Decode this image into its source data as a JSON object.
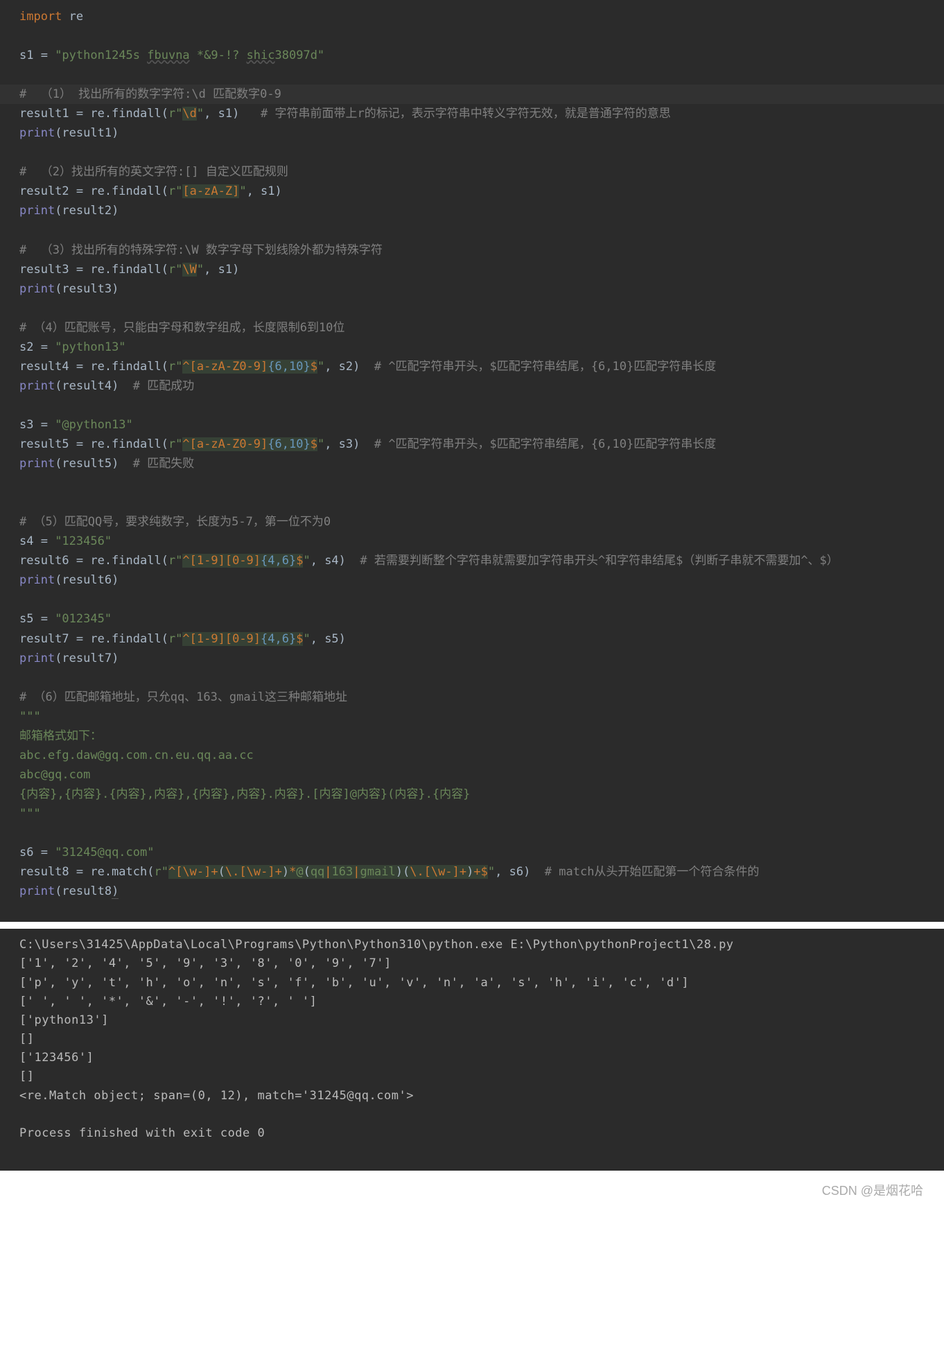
{
  "editor": {
    "lines": [
      {
        "segments": [
          {
            "text": "import ",
            "cls": "kw-import"
          },
          {
            "text": "re",
            "cls": "func"
          }
        ]
      },
      {
        "segments": []
      },
      {
        "segments": [
          {
            "text": "s1 = ",
            "cls": "punct"
          },
          {
            "text": "\"python1245s ",
            "cls": "str"
          },
          {
            "text": "fbuvna",
            "cls": "str-underline"
          },
          {
            "text": " *&9-!? ",
            "cls": "str"
          },
          {
            "text": "shic",
            "cls": "str-underline"
          },
          {
            "text": "38097d\"",
            "cls": "str"
          }
        ]
      },
      {
        "segments": []
      },
      {
        "highlighted": true,
        "segments": [
          {
            "text": "#  （1） 找出所有的数字字符:\\d 匹配数字0-9",
            "cls": "comment"
          }
        ]
      },
      {
        "segments": [
          {
            "text": "result1 = re.findall(",
            "cls": "punct"
          },
          {
            "text": "r\"",
            "cls": "str"
          },
          {
            "text": "\\d",
            "cls": "regex-esc"
          },
          {
            "text": "\"",
            "cls": "str"
          },
          {
            "text": ", s1)   ",
            "cls": "punct"
          },
          {
            "text": "# 字符串前面带上r的标记，表示字符串中转义字符无效，就是普通字符的意思",
            "cls": "comment"
          }
        ]
      },
      {
        "segments": [
          {
            "text": "print",
            "cls": "builtin"
          },
          {
            "text": "(result1)",
            "cls": "punct"
          }
        ]
      },
      {
        "segments": []
      },
      {
        "segments": [
          {
            "text": "#  （2）找出所有的英文字符:[] 自定义匹配规则",
            "cls": "comment"
          }
        ]
      },
      {
        "segments": [
          {
            "text": "result2 = re.findall(",
            "cls": "punct"
          },
          {
            "text": "r\"",
            "cls": "str"
          },
          {
            "text": "[a-zA-Z]",
            "cls": "regex-charclass"
          },
          {
            "text": "\"",
            "cls": "str"
          },
          {
            "text": ", s1)",
            "cls": "punct"
          }
        ]
      },
      {
        "segments": [
          {
            "text": "print",
            "cls": "builtin"
          },
          {
            "text": "(result2)",
            "cls": "punct"
          }
        ]
      },
      {
        "segments": []
      },
      {
        "segments": [
          {
            "text": "#  （3）找出所有的特殊字符:\\W 数字字母下划线除外都为特殊字符",
            "cls": "comment"
          }
        ]
      },
      {
        "segments": [
          {
            "text": "result3 = re.findall(",
            "cls": "punct"
          },
          {
            "text": "r\"",
            "cls": "str"
          },
          {
            "text": "\\W",
            "cls": "regex-esc"
          },
          {
            "text": "\"",
            "cls": "str"
          },
          {
            "text": ", s1)",
            "cls": "punct"
          }
        ]
      },
      {
        "segments": [
          {
            "text": "print",
            "cls": "builtin"
          },
          {
            "text": "(result3)",
            "cls": "punct"
          }
        ]
      },
      {
        "segments": []
      },
      {
        "segments": [
          {
            "text": "# （4）匹配账号，只能由字母和数字组成，长度限制6到10位",
            "cls": "comment"
          }
        ]
      },
      {
        "segments": [
          {
            "text": "s2 = ",
            "cls": "punct"
          },
          {
            "text": "\"python13\"",
            "cls": "str"
          }
        ]
      },
      {
        "segments": [
          {
            "text": "result4 = re.findall(",
            "cls": "punct"
          },
          {
            "text": "r\"",
            "cls": "str"
          },
          {
            "text": "^",
            "cls": "regex-anchor"
          },
          {
            "text": "[a-zA-Z0-9]",
            "cls": "regex-charclass"
          },
          {
            "text": "{6,10}",
            "cls": "regex-quant"
          },
          {
            "text": "$",
            "cls": "regex-anchor"
          },
          {
            "text": "\"",
            "cls": "str"
          },
          {
            "text": ", s2)  ",
            "cls": "punct"
          },
          {
            "text": "# ^匹配字符串开头，$匹配字符串结尾，{6,10}匹配字符串长度",
            "cls": "comment"
          }
        ]
      },
      {
        "segments": [
          {
            "text": "print",
            "cls": "builtin"
          },
          {
            "text": "(result4)  ",
            "cls": "punct"
          },
          {
            "text": "# 匹配成功",
            "cls": "comment"
          }
        ]
      },
      {
        "segments": []
      },
      {
        "segments": [
          {
            "text": "s3 = ",
            "cls": "punct"
          },
          {
            "text": "\"@python13\"",
            "cls": "str"
          }
        ]
      },
      {
        "segments": [
          {
            "text": "result5 = re.findall(",
            "cls": "punct"
          },
          {
            "text": "r\"",
            "cls": "str"
          },
          {
            "text": "^",
            "cls": "regex-anchor"
          },
          {
            "text": "[a-zA-Z0-9]",
            "cls": "regex-charclass"
          },
          {
            "text": "{6,10}",
            "cls": "regex-quant"
          },
          {
            "text": "$",
            "cls": "regex-anchor"
          },
          {
            "text": "\"",
            "cls": "str"
          },
          {
            "text": ", s3)  ",
            "cls": "punct"
          },
          {
            "text": "# ^匹配字符串开头，$匹配字符串结尾，{6,10}匹配字符串长度",
            "cls": "comment"
          }
        ]
      },
      {
        "segments": [
          {
            "text": "print",
            "cls": "builtin"
          },
          {
            "text": "(result5)  ",
            "cls": "punct"
          },
          {
            "text": "# 匹配失败",
            "cls": "comment"
          }
        ]
      },
      {
        "segments": []
      },
      {
        "segments": []
      },
      {
        "segments": [
          {
            "text": "# （5）匹配QQ号，要求纯数字，长度为5-7，第一位不为0",
            "cls": "comment"
          }
        ]
      },
      {
        "segments": [
          {
            "text": "s4 = ",
            "cls": "punct"
          },
          {
            "text": "\"123456\"",
            "cls": "str"
          }
        ]
      },
      {
        "segments": [
          {
            "text": "result6 = re.findall(",
            "cls": "punct"
          },
          {
            "text": "r\"",
            "cls": "str"
          },
          {
            "text": "^",
            "cls": "regex-anchor"
          },
          {
            "text": "[1-9][0-9]",
            "cls": "regex-charclass"
          },
          {
            "text": "{4,6}",
            "cls": "regex-quant"
          },
          {
            "text": "$",
            "cls": "regex-anchor"
          },
          {
            "text": "\"",
            "cls": "str"
          },
          {
            "text": ", s4)  ",
            "cls": "punct"
          },
          {
            "text": "# 若需要判断整个字符串就需要加字符串开头^和字符串结尾$（判断子串就不需要加^、$）",
            "cls": "comment"
          }
        ]
      },
      {
        "segments": [
          {
            "text": "print",
            "cls": "builtin"
          },
          {
            "text": "(result6)",
            "cls": "punct"
          }
        ]
      },
      {
        "segments": []
      },
      {
        "segments": [
          {
            "text": "s5 = ",
            "cls": "punct"
          },
          {
            "text": "\"012345\"",
            "cls": "str"
          }
        ]
      },
      {
        "segments": [
          {
            "text": "result7 = re.findall(",
            "cls": "punct"
          },
          {
            "text": "r\"",
            "cls": "str"
          },
          {
            "text": "^",
            "cls": "regex-anchor"
          },
          {
            "text": "[1-9][0-9]",
            "cls": "regex-charclass"
          },
          {
            "text": "{4,6}",
            "cls": "regex-quant"
          },
          {
            "text": "$",
            "cls": "regex-anchor"
          },
          {
            "text": "\"",
            "cls": "str"
          },
          {
            "text": ", s5)",
            "cls": "punct"
          }
        ]
      },
      {
        "segments": [
          {
            "text": "print",
            "cls": "builtin"
          },
          {
            "text": "(result7)",
            "cls": "punct"
          }
        ]
      },
      {
        "segments": []
      },
      {
        "segments": [
          {
            "text": "# （6）匹配邮箱地址，只允qq、163、gmail这三种邮箱地址",
            "cls": "comment"
          }
        ]
      },
      {
        "segments": [
          {
            "text": "\"\"\"",
            "cls": "str"
          }
        ]
      },
      {
        "segments": [
          {
            "text": "邮箱格式如下：",
            "cls": "str"
          }
        ]
      },
      {
        "segments": [
          {
            "text": "abc.efg.daw@gq.com.cn.eu.qq.aa.cc",
            "cls": "str"
          }
        ]
      },
      {
        "segments": [
          {
            "text": "abc@gq.com",
            "cls": "str"
          }
        ]
      },
      {
        "segments": [
          {
            "text": "{内容},{内容}.{内容},内容},{内容},内容}.内容}.[内容]@内容}(内容}.{内容}",
            "cls": "str"
          }
        ]
      },
      {
        "segments": [
          {
            "text": "\"\"\"",
            "cls": "str"
          }
        ]
      },
      {
        "segments": []
      },
      {
        "segments": [
          {
            "text": "s6 = ",
            "cls": "punct"
          },
          {
            "text": "\"31245@qq.com\"",
            "cls": "str"
          }
        ]
      },
      {
        "segments": [
          {
            "text": "result8 = re.match(",
            "cls": "punct"
          },
          {
            "text": "r\"",
            "cls": "str"
          },
          {
            "text": "^",
            "cls": "regex-anchor"
          },
          {
            "text": "[\\w-]",
            "cls": "regex-charclass"
          },
          {
            "text": "+",
            "cls": "regex-anchor"
          },
          {
            "text": "(",
            "cls": "regex-paren"
          },
          {
            "text": "\\.",
            "cls": "regex-esc"
          },
          {
            "text": "[\\w-]",
            "cls": "regex-charclass"
          },
          {
            "text": "+",
            "cls": "regex-anchor"
          },
          {
            "text": ")",
            "cls": "regex-paren"
          },
          {
            "text": "*",
            "cls": "regex-anchor"
          },
          {
            "text": "@",
            "cls": "regex-plain"
          },
          {
            "text": "(",
            "cls": "regex-paren"
          },
          {
            "text": "qq",
            "cls": "regex-plain"
          },
          {
            "text": "|",
            "cls": "regex-alt"
          },
          {
            "text": "163",
            "cls": "regex-plain"
          },
          {
            "text": "|",
            "cls": "regex-alt"
          },
          {
            "text": "gmail",
            "cls": "regex-plain"
          },
          {
            "text": ")",
            "cls": "regex-paren"
          },
          {
            "text": "(",
            "cls": "regex-paren"
          },
          {
            "text": "\\.",
            "cls": "regex-esc"
          },
          {
            "text": "[\\w-]",
            "cls": "regex-charclass"
          },
          {
            "text": "+",
            "cls": "regex-anchor"
          },
          {
            "text": ")",
            "cls": "regex-paren"
          },
          {
            "text": "+",
            "cls": "regex-anchor"
          },
          {
            "text": "$",
            "cls": "regex-anchor"
          },
          {
            "text": "\"",
            "cls": "str"
          },
          {
            "text": ", s6)  ",
            "cls": "punct"
          },
          {
            "text": "# match从头开始匹配第一个符合条件的",
            "cls": "comment"
          }
        ]
      },
      {
        "segments": [
          {
            "text": "print",
            "cls": "builtin"
          },
          {
            "text": "(result8",
            "cls": "punct"
          },
          {
            "text": ")",
            "cls": "punct underline-ref"
          }
        ]
      }
    ]
  },
  "console": {
    "lines": [
      "C:\\Users\\31425\\AppData\\Local\\Programs\\Python\\Python310\\python.exe E:\\Python\\pythonProject1\\28.py",
      "['1', '2', '4', '5', '9', '3', '8', '0', '9', '7']",
      "['p', 'y', 't', 'h', 'o', 'n', 's', 'f', 'b', 'u', 'v', 'n', 'a', 's', 'h', 'i', 'c', 'd']",
      "[' ', ' ', '*', '&', '-', '!', '?', ' ']",
      "['python13']",
      "[]",
      "['123456']",
      "[]",
      "<re.Match object; span=(0, 12), match='31245@qq.com'>",
      "",
      "Process finished with exit code 0"
    ]
  },
  "watermark": "CSDN @是烟花哈"
}
